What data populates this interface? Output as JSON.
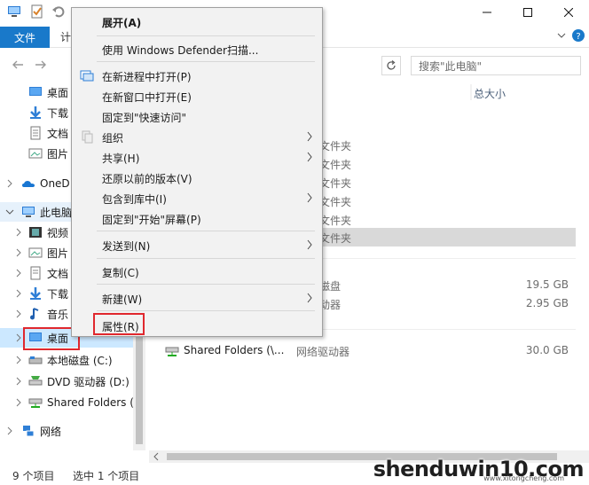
{
  "ribbon": {
    "file_tab": "文件",
    "compute_tab": "计"
  },
  "search": {
    "placeholder": "搜索\"此电脑\""
  },
  "columns": {
    "total_size": "总大小"
  },
  "nav": {
    "items": [
      {
        "label": "桌面",
        "icon": "desktop-icon"
      },
      {
        "label": "下载",
        "icon": "download-icon"
      },
      {
        "label": "文档",
        "icon": "documents-icon"
      },
      {
        "label": "图片",
        "icon": "pictures-icon"
      },
      {
        "label": "OneD",
        "icon": "onedrive-icon"
      },
      {
        "label": "此电脑",
        "icon": "computer-icon"
      },
      {
        "label": "视频",
        "icon": "video-icon"
      },
      {
        "label": "图片",
        "icon": "pictures-icon"
      },
      {
        "label": "文档",
        "icon": "documents-icon"
      },
      {
        "label": "下载",
        "icon": "download-icon"
      },
      {
        "label": "音乐",
        "icon": "music-icon"
      },
      {
        "label": "桌面",
        "icon": "desktop-icon"
      },
      {
        "label": "本地磁盘 (C:)",
        "icon": "local-disk-icon"
      },
      {
        "label": "DVD 驱动器 (D:) .",
        "icon": "dvd-drive-icon"
      },
      {
        "label": "Shared Folders (",
        "icon": "network-drive-icon"
      },
      {
        "label": "网络",
        "icon": "network-icon"
      }
    ]
  },
  "content": {
    "folder_type": "文件夹",
    "drives": [
      {
        "name": "",
        "type": "磁盘",
        "size": "19.5 GB"
      },
      {
        "name": "",
        "type": "动器",
        "size": "2.95 GB"
      },
      {
        "name": "Shared Folders (\\...",
        "type": "网络驱动器",
        "size": "30.0 GB"
      }
    ]
  },
  "status": {
    "item_count": "9 个项目",
    "selected": "选中 1 个项目"
  },
  "menu": {
    "expand": "展开(A)",
    "defender": "使用 Windows Defender扫描...",
    "open_new_process": "在新进程中打开(P)",
    "open_new_window": "在新窗口中打开(E)",
    "pin_quick_access": "固定到\"快速访问\"",
    "organize": "组织",
    "share": "共享(H)",
    "restore_versions": "还原以前的版本(V)",
    "include_library": "包含到库中(I)",
    "pin_start": "固定到\"开始\"屏幕(P)",
    "send_to": "发送到(N)",
    "copy": "复制(C)",
    "new": "新建(W)",
    "properties": "属性(R)"
  },
  "watermark": {
    "main": "shenduwin10.com",
    "sub": "www.xitongcheng.com"
  },
  "colors": {
    "accent": "#1979ca",
    "highlight_box": "#e0282e"
  }
}
